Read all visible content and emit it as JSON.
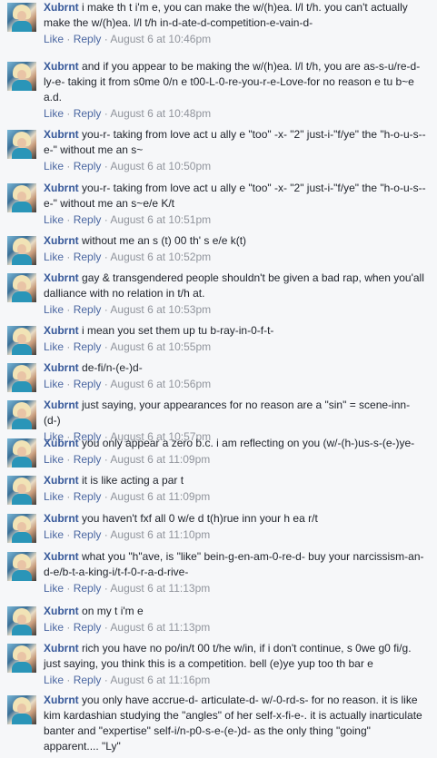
{
  "actions": {
    "like": "Like",
    "reply": "Reply",
    "sep": " · "
  },
  "comments": [
    {
      "author": "Xubrnt",
      "text": "i make th t i'm e, you can make the w/(h)ea. l/l t/h. you can't actually make the w/(h)ea. l/l t/h in-d-ate-d-competition-e-vain-d-",
      "time": "August 6 at 10:46pm"
    },
    {
      "author": "Xubrnt",
      "text": "and if you appear to be making the w/(h)ea. l/l t/h, you are as-s-u/re-d-ly-e- taking it from s0me 0/n e t00-L-0-re-you-r-e-Love-for no reason e tu b~e a.d.",
      "time": "August 6 at 10:48pm"
    },
    {
      "author": "Xubrnt",
      "text": "you-r- taking from love act u ally e \"too\" -x- \"2\" just-i-\"f/ye\" the \"h-o-u-s--e-\" without me an s~",
      "time": "August 6 at 10:50pm"
    },
    {
      "author": "Xubrnt",
      "text": "you-r- taking from love act u ally e \"too\" -x- \"2\" just-i-\"f/ye\" the \"h-o-u-s--e-\" without me an s~e/e K/t",
      "time": "August 6 at 10:51pm"
    },
    {
      "author": "Xubrnt",
      "text": "without me an s (t) 00 th' s e/e k(t)",
      "time": "August 6 at 10:52pm"
    },
    {
      "author": "Xubrnt",
      "text": "gay & transgendered people shouldn't be given a bad rap, when you'all dalliance with no relation in t/h at.",
      "time": "August 6 at 10:53pm"
    },
    {
      "author": "Xubrnt",
      "text": "i mean you set them up tu b-ray-in-0-f-t-",
      "time": "August 6 at 10:55pm"
    },
    {
      "author": "Xubrnt",
      "text": "de-fi/n-(e-)d-",
      "time": "August 6 at 10:56pm"
    },
    {
      "author": "Xubrnt",
      "text": "just saying, your appearances for no reason are a \"sin\" = scene-inn-(d-)",
      "time": "August 6 at 10:57pm"
    },
    {
      "author": "Xubrnt",
      "text": "you only appear a zero b.c. i am reflecting on you (w/-(h-)us-s-(e-)ye-",
      "time": "August 6 at 11:09pm"
    },
    {
      "author": "Xubrnt",
      "text": "it is like acting a par t",
      "time": "August 6 at 11:09pm"
    },
    {
      "author": "Xubrnt",
      "text": "you haven't fxf all 0 w/e d t(h)rue inn your h ea r/t",
      "time": "August 6 at 11:10pm"
    },
    {
      "author": "Xubrnt",
      "text": "what you \"h\"ave, is \"like\" bein-g-en-am-0-re-d- buy your narcissism-an-d-e/b-t-a-king-i/t-f-0-r-a-d-rive-",
      "time": "August 6 at 11:13pm"
    },
    {
      "author": "Xubrnt",
      "text": "on my t i'm e",
      "time": "August 6 at 11:13pm"
    },
    {
      "author": "Xubrnt",
      "text": "rich you have no po/in/t 00 t/he w/in, if i don't continue, s 0we g0 fi/g. just saying, you think this is a competition. bell (e)ye yup too th bar e",
      "time": "August 6 at 11:16pm"
    },
    {
      "author": "Xubrnt",
      "text": "you only have accrue-d- articulate-d- w/-0-rd-s- for no reason. it is like kim kardashian studying the \"angles\" of her self-x-fi-e-. it is actually inarticulate banter and \"expertise\" self-i/n-p0-s-e-(e-)d- as the only thing \"going\" apparent.... \"Ly\"",
      "time": ""
    }
  ]
}
